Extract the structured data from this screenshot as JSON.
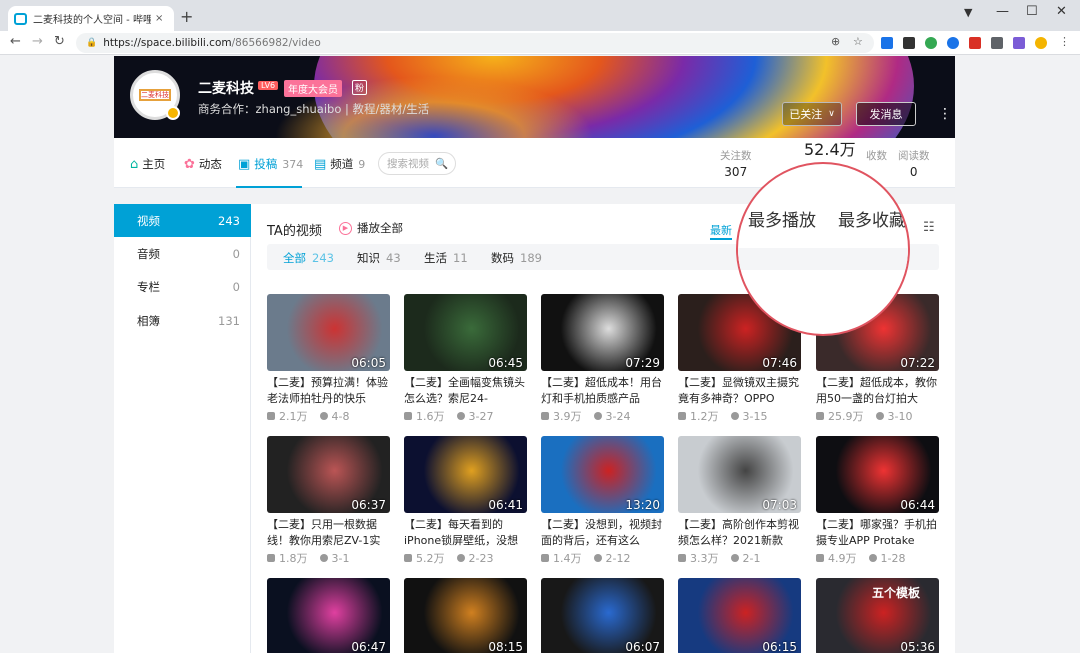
{
  "browser": {
    "tab_title": "二麦科技的个人空间 - 哔哩哔哩",
    "tab_close": "×",
    "new_tab": "+",
    "url_host": "https://space.bilibili.com",
    "url_path": "/86566982/video",
    "window_controls": [
      "—",
      "☐",
      "✕"
    ],
    "extension_colors": [
      "#1a73e8",
      "#333333",
      "#34a853",
      "#1a73e8",
      "#d93025",
      "#5f6368",
      "#7b5cd6",
      "#5f6368",
      "#f4b400"
    ]
  },
  "profile": {
    "name": "二麦科技",
    "level": "LV6",
    "vip": "年度大会员",
    "tag": "粉",
    "bio": "商务合作：zhang_shuaibo | 教程/器材/生活",
    "follow_btn": "已关注",
    "message_btn": "发消息",
    "more_icon": "⋮"
  },
  "nav": {
    "items": [
      {
        "label": "主页",
        "count": ""
      },
      {
        "label": "动态",
        "count": ""
      },
      {
        "label": "投稿",
        "count": "374"
      },
      {
        "label": "频道",
        "count": "9"
      }
    ],
    "search_placeholder": "搜索视频",
    "stats": [
      {
        "label": "关注数",
        "value": "307"
      },
      {
        "label": "",
        "value": "52.4万"
      },
      {
        "label": "收数",
        "value": ""
      },
      {
        "label": "阅读数",
        "value": "0"
      }
    ]
  },
  "sidebar": {
    "items": [
      {
        "label": "视频",
        "count": "243"
      },
      {
        "label": "音频",
        "count": "0"
      },
      {
        "label": "专栏",
        "count": "0"
      },
      {
        "label": "相簿",
        "count": "131"
      }
    ]
  },
  "main": {
    "title": "TA的视频",
    "play_all": "播放全部",
    "sort_latest": "最新",
    "filters": [
      {
        "label": "全部",
        "count": "243"
      },
      {
        "label": "知识",
        "count": "43"
      },
      {
        "label": "生活",
        "count": "11"
      },
      {
        "label": "数码",
        "count": "189"
      }
    ]
  },
  "magnifier": {
    "most_played": "最多播放",
    "most_favorited": "最多收藏"
  },
  "videos": [
    {
      "title": "【二麦】预算拉满！体验老法师拍牡丹的快乐",
      "duration": "06:05",
      "plays": "2.1万",
      "date": "4-8",
      "bg": "#6b7b8c",
      "accent": "#c33"
    },
    {
      "title": "【二麦】全画幅变焦镜头怎么选？索尼24-",
      "duration": "06:45",
      "plays": "1.6万",
      "date": "3-27",
      "bg": "#1c2a1c",
      "accent": "#3a6b3a"
    },
    {
      "title": "【二麦】超低成本！用台灯和手机拍质感产品",
      "duration": "07:29",
      "plays": "3.9万",
      "date": "3-24",
      "bg": "#111",
      "accent": "#ddd"
    },
    {
      "title": "【二麦】显微镜双主摄究竟有多神奇？OPPO",
      "duration": "07:46",
      "plays": "1.2万",
      "date": "3-15",
      "bg": "#2b1f1c",
      "accent": "#c22"
    },
    {
      "title": "【二麦】超低成本，教你用50一盏的台灯拍大",
      "duration": "07:22",
      "plays": "25.9万",
      "date": "3-10",
      "bg": "#3a2a2a",
      "accent": "#e33"
    },
    {
      "title": "【二麦】只用一根数据线！教你用索尼ZV-1实",
      "duration": "06:37",
      "plays": "1.8万",
      "date": "3-1",
      "bg": "#222",
      "accent": "#b55"
    },
    {
      "title": "【二麦】每天看到的iPhone锁屏壁纸，没想",
      "duration": "06:41",
      "plays": "5.2万",
      "date": "2-23",
      "bg": "#0c1030",
      "accent": "#e0a020"
    },
    {
      "title": "【二麦】没想到，视频封面的背后，还有这么",
      "duration": "13:20",
      "plays": "1.4万",
      "date": "2-12",
      "bg": "#1a6fc0",
      "accent": "#c22"
    },
    {
      "title": "【二麦】高阶创作本剪视频怎么样？2021新款",
      "duration": "07:03",
      "plays": "3.3万",
      "date": "2-1",
      "bg": "#c8ccd0",
      "accent": "#444"
    },
    {
      "title": "【二麦】哪家强？手机拍摄专业APP Protake",
      "duration": "06:44",
      "plays": "4.9万",
      "date": "1-28",
      "bg": "#0e0e12",
      "accent": "#e33"
    },
    {
      "title": "",
      "duration": "06:47",
      "plays": "",
      "date": "",
      "bg": "#0a1020",
      "accent": "#e040a0"
    },
    {
      "title": "",
      "duration": "08:15",
      "plays": "",
      "date": "",
      "bg": "#111",
      "accent": "#d08020"
    },
    {
      "title": "",
      "duration": "06:07",
      "plays": "",
      "date": "",
      "bg": "#181818",
      "accent": "#2a6ad0"
    },
    {
      "title": "",
      "duration": "06:15",
      "plays": "",
      "date": "",
      "bg": "#163a80",
      "accent": "#c22"
    },
    {
      "title": "",
      "duration": "05:36",
      "plays": "",
      "date": "",
      "bg": "#2a2a30",
      "accent": "#c22",
      "overlay": "五个模板"
    }
  ]
}
